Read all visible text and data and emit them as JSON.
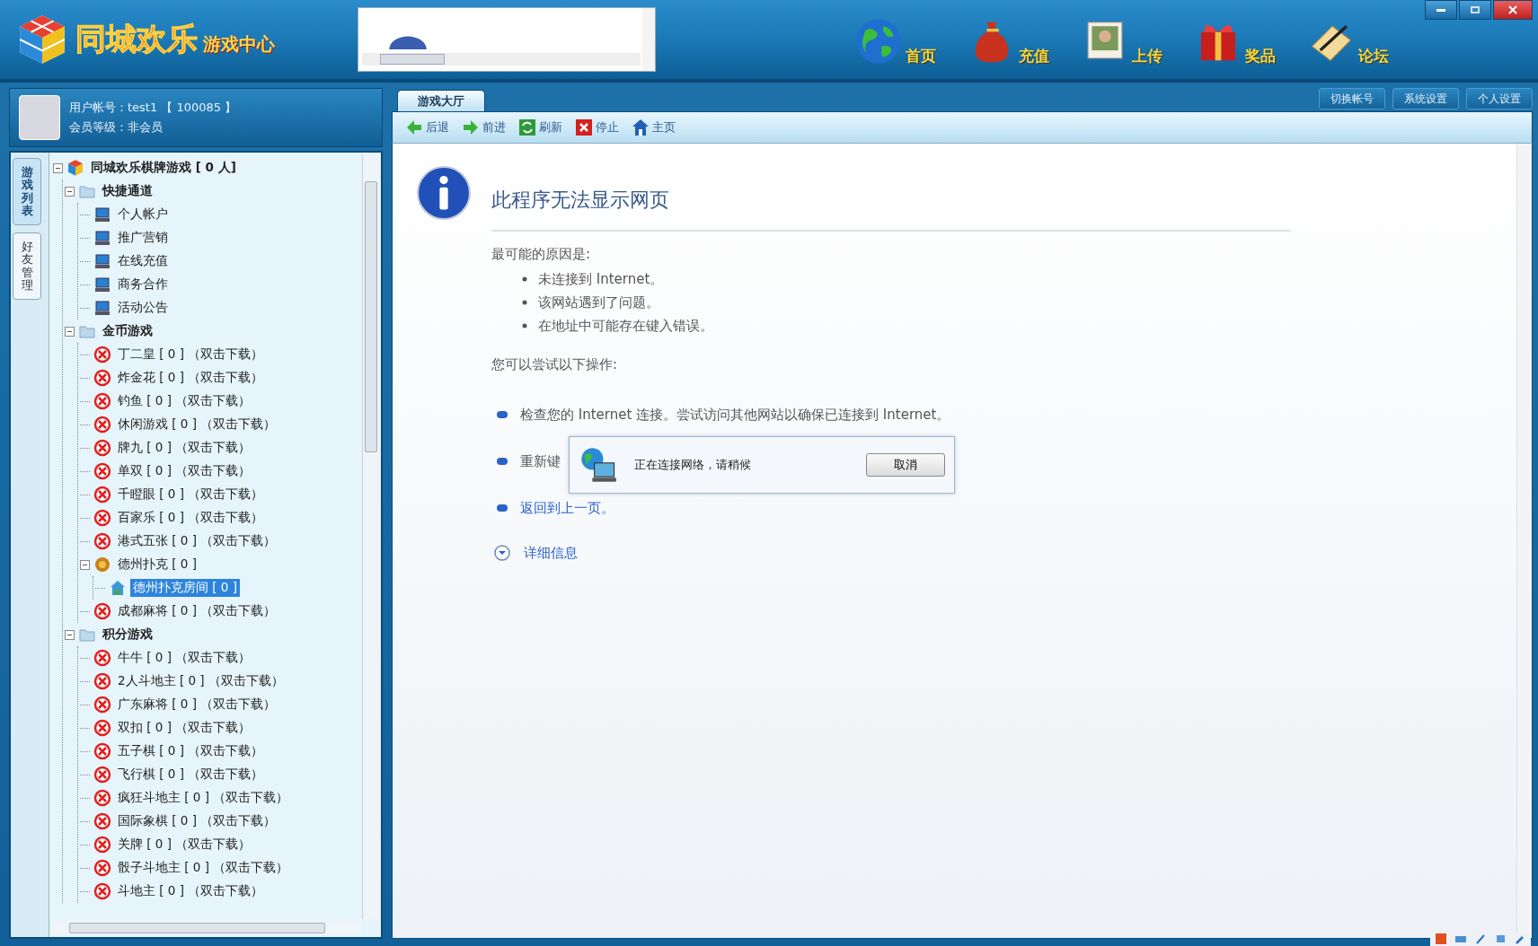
{
  "app": {
    "logo_title": "同城欢乐",
    "logo_subtitle": "游戏中心"
  },
  "nav": [
    {
      "label": "首页",
      "kind": "globe"
    },
    {
      "label": "充值",
      "kind": "bag"
    },
    {
      "label": "上传",
      "kind": "photo"
    },
    {
      "label": "奖品",
      "kind": "gift"
    },
    {
      "label": "论坛",
      "kind": "scroll"
    }
  ],
  "account_buttons": [
    "切换帐号",
    "系统设置",
    "个人设置"
  ],
  "user": {
    "account": "用户帐号：test1 【 100085 】",
    "level": "会员等级：非会员"
  },
  "side_tabs": [
    {
      "label": "游戏列表",
      "selected": true
    },
    {
      "label": "好友管理",
      "selected": false
    }
  ],
  "tree": {
    "label": "同城欢乐棋牌游戏 [ 0 人]",
    "expanded": true,
    "children": [
      {
        "label": "快捷通道",
        "expanded": true,
        "children": [
          {
            "label": "个人帐户",
            "kind": "link",
            "selected": false
          },
          {
            "label": "推广营销",
            "kind": "link",
            "selected": false
          },
          {
            "label": "在线充值",
            "kind": "link",
            "selected": false
          },
          {
            "label": "商务合作",
            "kind": "link",
            "selected": false
          },
          {
            "label": "活动公告",
            "kind": "link",
            "selected": false
          }
        ]
      },
      {
        "label": "金币游戏",
        "expanded": true,
        "children": [
          {
            "label": "丁二皇 [ 0 ] （双击下载）",
            "kind": "download",
            "selected": false
          },
          {
            "label": "炸金花 [ 0 ] （双击下载）",
            "kind": "download",
            "selected": false
          },
          {
            "label": "钓鱼 [ 0 ] （双击下载）",
            "kind": "download",
            "selected": false
          },
          {
            "label": "休闲游戏 [ 0 ] （双击下载）",
            "kind": "download",
            "selected": false
          },
          {
            "label": "牌九 [ 0 ] （双击下载）",
            "kind": "download",
            "selected": false
          },
          {
            "label": "单双 [ 0 ] （双击下载）",
            "kind": "download",
            "selected": false
          },
          {
            "label": "千瞪眼 [ 0 ] （双击下载）",
            "kind": "download",
            "selected": false
          },
          {
            "label": "百家乐 [ 0 ] （双击下载）",
            "kind": "download",
            "selected": false
          },
          {
            "label": "港式五张 [ 0 ] （双击下载）",
            "kind": "download",
            "selected": false
          },
          {
            "label": "德州扑克 [ 0 ]",
            "kind": "game",
            "expanded": true,
            "selected": false,
            "children": [
              {
                "label": "德州扑克房间 [ 0 ]",
                "kind": "room",
                "selected": true
              }
            ]
          },
          {
            "label": "成都麻将 [ 0 ] （双击下载）",
            "kind": "download",
            "selected": false
          }
        ]
      },
      {
        "label": "积分游戏",
        "expanded": true,
        "children": [
          {
            "label": "牛牛 [ 0 ] （双击下载）",
            "kind": "download",
            "selected": false
          },
          {
            "label": "2人斗地主 [ 0 ] （双击下载）",
            "kind": "download",
            "selected": false
          },
          {
            "label": "广东麻将 [ 0 ] （双击下载）",
            "kind": "download",
            "selected": false
          },
          {
            "label": "双扣 [ 0 ] （双击下载）",
            "kind": "download",
            "selected": false
          },
          {
            "label": "五子棋 [ 0 ] （双击下载）",
            "kind": "download",
            "selected": false
          },
          {
            "label": "飞行棋 [ 0 ] （双击下载）",
            "kind": "download",
            "selected": false
          },
          {
            "label": "疯狂斗地主 [ 0 ] （双击下载）",
            "kind": "download",
            "selected": false
          },
          {
            "label": "国际象棋 [ 0 ] （双击下载）",
            "kind": "download",
            "selected": false
          },
          {
            "label": "关牌 [ 0 ] （双击下载）",
            "kind": "download",
            "selected": false
          },
          {
            "label": "骰子斗地主 [ 0 ] （双击下载）",
            "kind": "download",
            "selected": false
          },
          {
            "label": "斗地主 [ 0 ] （双击下载）",
            "kind": "download",
            "selected": false
          }
        ]
      }
    ]
  },
  "browser": {
    "tabs": [
      {
        "label": "游戏大厅",
        "selected": true
      }
    ],
    "toolbar": [
      {
        "label": "后退",
        "kind": "back"
      },
      {
        "label": "前进",
        "kind": "forward"
      },
      {
        "label": "刷新",
        "kind": "refresh"
      },
      {
        "label": "停止",
        "kind": "stop"
      },
      {
        "label": "主页",
        "kind": "home"
      }
    ],
    "page": {
      "title": "此程序无法显示网页",
      "reasons_heading": "最可能的原因是:",
      "reasons": [
        "未连接到 Internet。",
        "该网站遇到了问题。",
        "在地址中可能存在键入错误。"
      ],
      "actions_heading": "您可以尝试以下操作:",
      "actions": [
        {
          "text": "检查您的 Internet 连接。尝试访问其他网站以确保已连接到 Internet。",
          "kind": "text"
        },
        {
          "text": "重新键",
          "kind": "text"
        },
        {
          "text": "返回到上一页。",
          "kind": "link"
        }
      ],
      "details": "详细信息"
    }
  },
  "dialog": {
    "message": "正在连接网络，请稍候",
    "button": "取消"
  }
}
